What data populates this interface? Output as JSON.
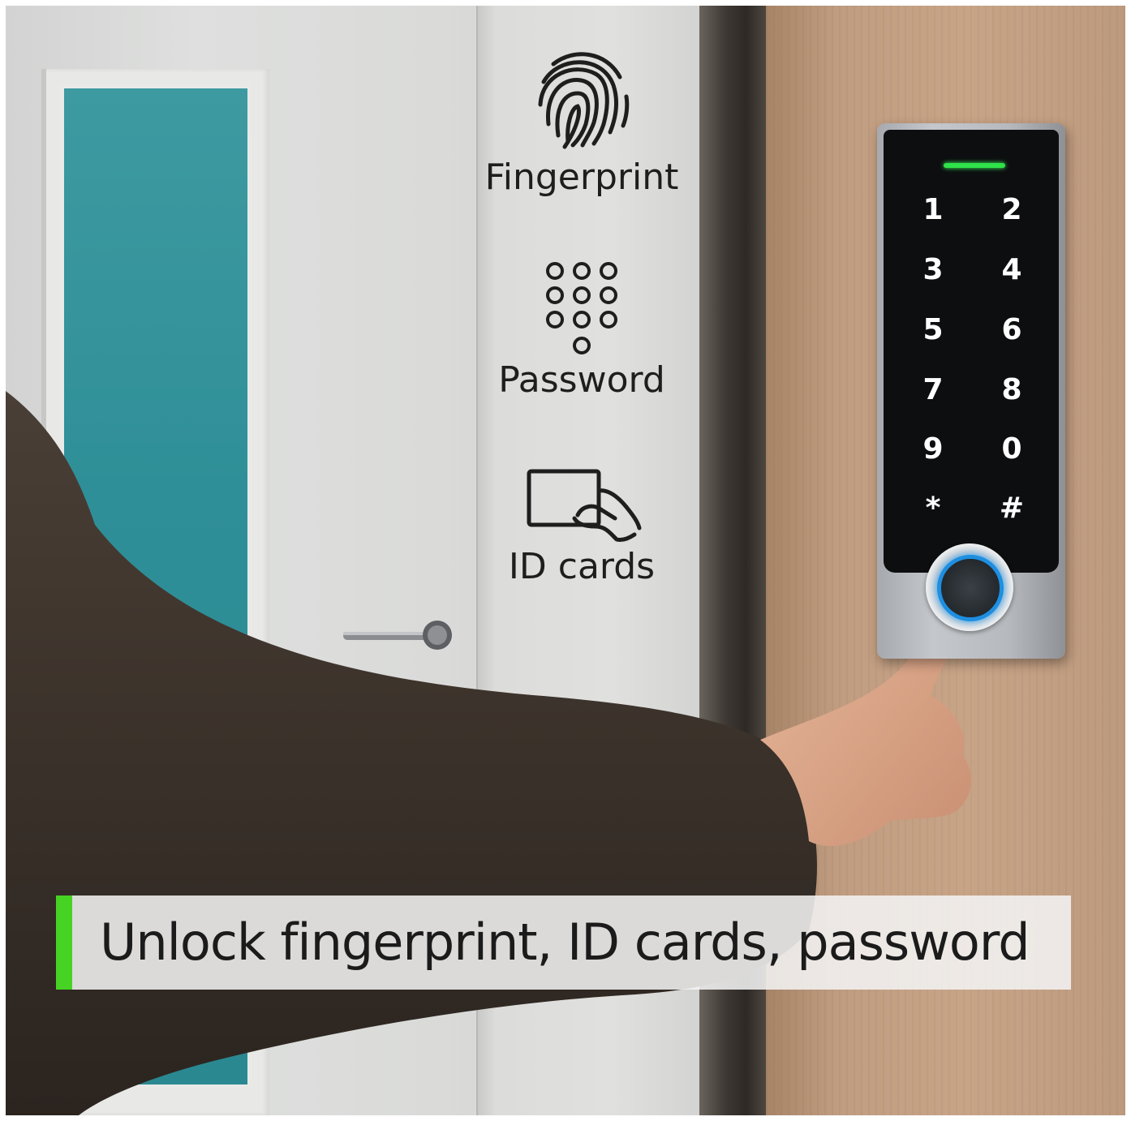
{
  "features": [
    {
      "label": "Fingerprint",
      "icon": "fingerprint-icon"
    },
    {
      "label": "Password",
      "icon": "keypad-icon"
    },
    {
      "label": "ID cards",
      "icon": "id-card-icon"
    }
  ],
  "keypad": {
    "keys": [
      "1",
      "2",
      "3",
      "4",
      "5",
      "6",
      "7",
      "8",
      "9",
      "0",
      "*",
      "#"
    ],
    "led_color": "#2fe24a",
    "sensor_ring_color": "#1e8fe0"
  },
  "banner": {
    "text": "Unlock fingerprint, ID cards, password",
    "accent_color": "#46d323"
  }
}
